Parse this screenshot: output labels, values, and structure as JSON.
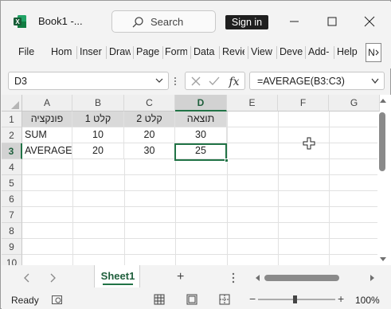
{
  "window": {
    "title": "Book1  -...",
    "search_placeholder": "Search",
    "sign_in_label": "Sign in"
  },
  "ribbon": {
    "tabs": [
      "File",
      "Hom",
      "Inser",
      "Draw",
      "Page",
      "Form",
      "Data",
      "Revie",
      "View",
      "Deve",
      "Add-",
      "Help"
    ],
    "more_label": "N"
  },
  "formula_bar": {
    "name_box": "D3",
    "formula": "=AVERAGE(B3:C3)"
  },
  "grid": {
    "columns": [
      "A",
      "B",
      "C",
      "D",
      "E",
      "F",
      "G"
    ],
    "selected_column": "D",
    "rows": [
      "1",
      "2",
      "3",
      "4",
      "5",
      "6",
      "7",
      "8",
      "9",
      "10"
    ],
    "selected_row": "3",
    "cells": {
      "A1": "פונקציה",
      "B1": "קלט 1",
      "C1": "קלט 2",
      "D1": "תוצאה",
      "A2": "SUM",
      "B2": "10",
      "C2": "20",
      "D2": "30",
      "A3": "AVERAGE",
      "B3": "20",
      "C3": "30",
      "D3": "25"
    },
    "active_cell": "D3",
    "header_fill": "#d9d9d9",
    "accent": "#217346"
  },
  "sheets": {
    "tabs": [
      "Sheet1"
    ],
    "active": "Sheet1",
    "add_label": "+"
  },
  "status": {
    "text": "Ready",
    "zoom": "100%",
    "zoom_minus": "−",
    "zoom_plus": "+"
  }
}
